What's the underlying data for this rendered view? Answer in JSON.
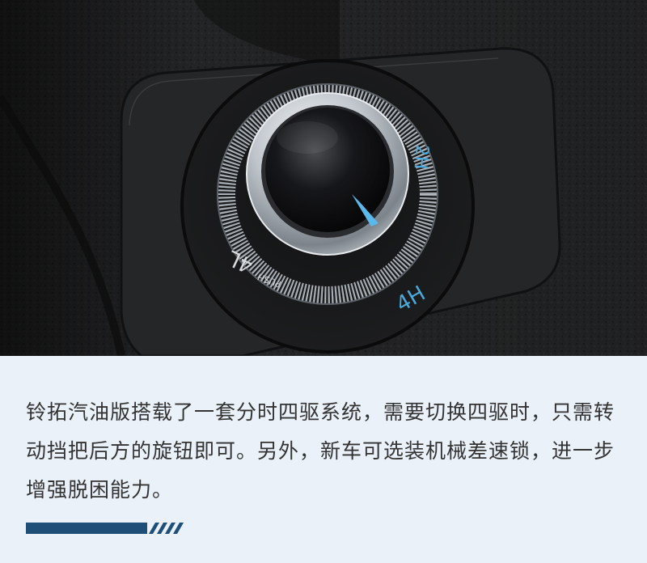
{
  "photo": {
    "dial_labels": {
      "two_h": "2H",
      "four_h": "4H",
      "four_l": "4L",
      "push": "PUSH"
    },
    "indicator_color": "#5bb8ea"
  },
  "caption": {
    "text": "铃拓汽油版搭载了一套分时四驱系统，需要切换四驱时，只需转动挡把后方的旋钮即可。另外，新车可选装机械差速锁，进一步增强脱困能力。"
  },
  "colors": {
    "panel_background": "#eaf1f9",
    "text": "#333333",
    "accent_bar": "#1f4e79"
  }
}
